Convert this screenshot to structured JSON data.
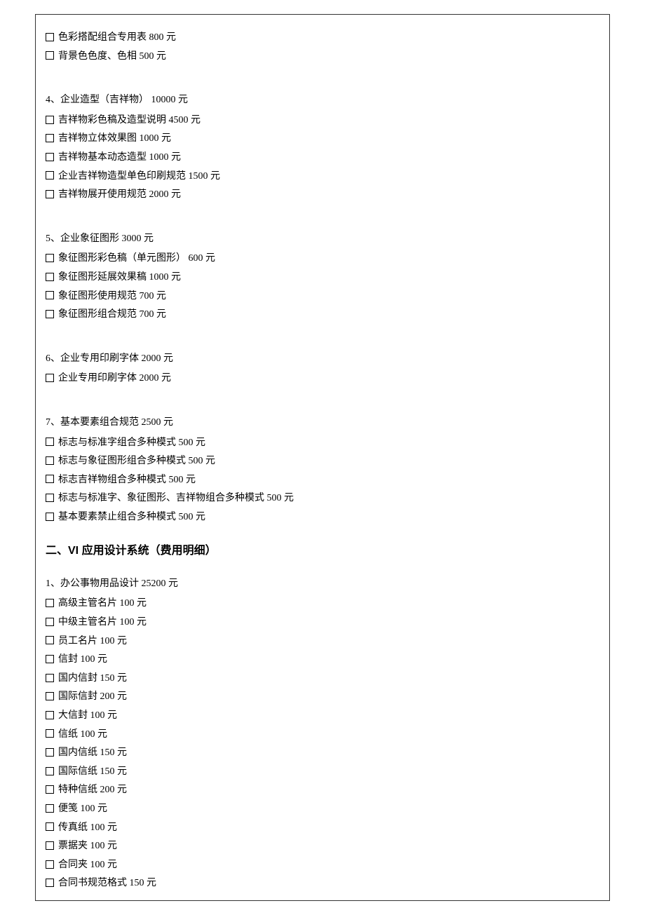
{
  "lines": [
    {
      "t": "cb",
      "text": "色彩搭配组合专用表 800 元"
    },
    {
      "t": "cb",
      "text": "背景色色度、色相 500 元"
    },
    {
      "t": "gap"
    },
    {
      "t": "sec",
      "text": "4、企业造型（吉祥物） 10000 元"
    },
    {
      "t": "cb",
      "text": "吉祥物彩色稿及造型说明 4500 元"
    },
    {
      "t": "cb",
      "text": "吉祥物立体效果图 1000 元"
    },
    {
      "t": "cb",
      "text": "吉祥物基本动态造型 1000 元"
    },
    {
      "t": "cb",
      "text": "企业吉祥物造型单色印刷规范 1500 元"
    },
    {
      "t": "cb",
      "text": "吉祥物展开使用规范 2000 元"
    },
    {
      "t": "gap"
    },
    {
      "t": "sec",
      "text": "5、企业象征图形 3000 元"
    },
    {
      "t": "cb",
      "text": "象征图形彩色稿（单元图形） 600 元"
    },
    {
      "t": "cb",
      "text": "象征图形延展效果稿 1000 元"
    },
    {
      "t": "cb",
      "text": "象征图形使用规范 700 元"
    },
    {
      "t": "cb",
      "text": "象征图形组合规范 700 元"
    },
    {
      "t": "gap"
    },
    {
      "t": "sec",
      "text": "6、企业专用印刷字体 2000 元"
    },
    {
      "t": "cb",
      "text": "企业专用印刷字体 2000 元"
    },
    {
      "t": "gap"
    },
    {
      "t": "sec",
      "text": "7、基本要素组合规范 2500 元"
    },
    {
      "t": "cb",
      "text": "标志与标准字组合多种模式 500 元"
    },
    {
      "t": "cb",
      "text": "标志与象征图形组合多种模式 500 元"
    },
    {
      "t": "cb",
      "text": "标志吉祥物组合多种模式 500 元"
    },
    {
      "t": "cb",
      "text": "标志与标准字、象征图形、吉祥物组合多种模式 500 元"
    },
    {
      "t": "cb",
      "text": "基本要素禁止组合多种模式 500 元"
    },
    {
      "t": "h2",
      "text": "二、VI 应用设计系统（费用明细）"
    },
    {
      "t": "sec",
      "text": "1、办公事物用品设计 25200 元"
    },
    {
      "t": "cb",
      "text": "高级主管名片 100 元"
    },
    {
      "t": "cb",
      "text": "中级主管名片 100 元"
    },
    {
      "t": "cb",
      "text": "员工名片 100 元"
    },
    {
      "t": "cb",
      "text": "信封 100 元"
    },
    {
      "t": "cb",
      "text": "国内信封 150 元"
    },
    {
      "t": "cb",
      "text": "国际信封 200 元"
    },
    {
      "t": "cb",
      "text": "大信封 100 元"
    },
    {
      "t": "cb",
      "text": "信纸 100 元"
    },
    {
      "t": "cb",
      "text": "国内信纸 150 元"
    },
    {
      "t": "cb",
      "text": "国际信纸 150 元"
    },
    {
      "t": "cb",
      "text": "特种信纸 200 元"
    },
    {
      "t": "cb",
      "text": "便笺 100 元"
    },
    {
      "t": "cb",
      "text": "传真纸 100 元"
    },
    {
      "t": "cb",
      "text": "票据夹 100 元"
    },
    {
      "t": "cb",
      "text": "合同夹 100 元"
    },
    {
      "t": "cb",
      "text": "合同书规范格式 150 元"
    }
  ]
}
